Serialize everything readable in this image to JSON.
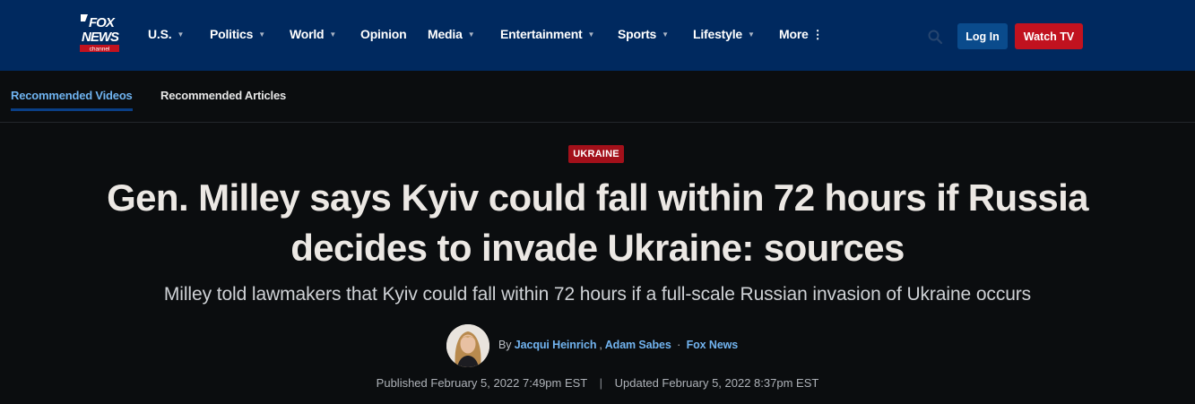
{
  "header": {
    "logo": {
      "line1": "FOX",
      "line2": "NEWS",
      "line3": "channel"
    },
    "nav": [
      {
        "label": "U.S.",
        "has_caret": true
      },
      {
        "label": "Politics",
        "has_caret": true
      },
      {
        "label": "World",
        "has_caret": true
      },
      {
        "label": "Opinion",
        "has_caret": false
      },
      {
        "label": "Media",
        "has_caret": true
      },
      {
        "label": "Entertainment",
        "has_caret": true
      },
      {
        "label": "Sports",
        "has_caret": true
      },
      {
        "label": "Lifestyle",
        "has_caret": true
      },
      {
        "label": "More",
        "has_caret": false
      }
    ],
    "search_icon": "search-icon",
    "login_label": "Log In",
    "watch_label": "Watch TV"
  },
  "tabs": {
    "active": "Recommended Videos",
    "inactive": "Recommended Articles"
  },
  "article": {
    "category": "UKRAINE",
    "headline": "Gen. Milley says Kyiv could fall within 72 hours if Russia decides to invade Ukraine: sources",
    "subhead": "Milley told lawmakers that Kyiv could fall within 72 hours if a full-scale Russian invasion of Ukraine occurs",
    "byline": {
      "by": "By",
      "authors": [
        "Jacqui Heinrich",
        "Adam Sabes"
      ],
      "source": "Fox News"
    },
    "published": "Published February 5, 2022 7:49pm EST",
    "updated": "Updated February 5, 2022 8:37pm EST"
  },
  "colors": {
    "header_bg": "#00295f",
    "page_bg": "#0b0d0f",
    "accent_red": "#c1121f",
    "link_blue": "#72b4f0"
  }
}
